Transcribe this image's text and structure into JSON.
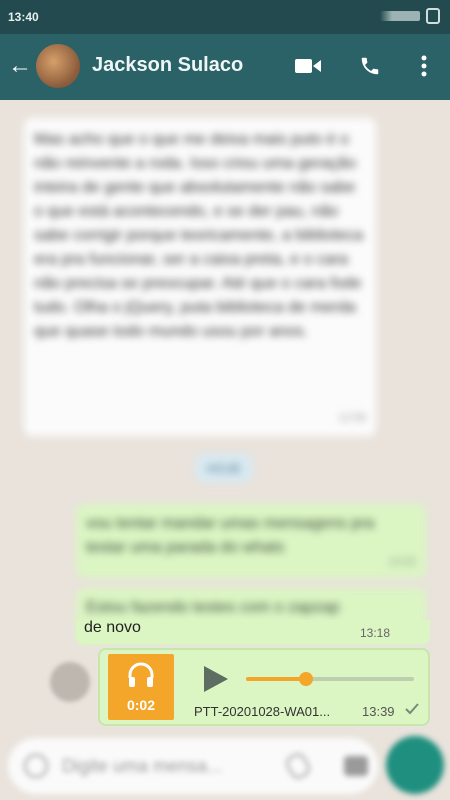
{
  "status": {
    "time": "13:40"
  },
  "header": {
    "contact_name": "Jackson Sulaco"
  },
  "messages": {
    "incoming_text": "Mas acho que o que me deixa mais puto é o não reinvente a roda. Isso criou uma geração inteira de gente que absolutamente não sabe o que está acontecendo, e se der pau, não sabe corrigir porque teoricamente, a biblioteca era pra funcionar, ser a caixa preta, e o cara não precisa se preocupar. Até que o cara fode tudo. Olha o jQuery, puta biblioteca de merda que quase todo mundo usou por anos.",
    "incoming_time": "12:58",
    "date_chip": "HOJE",
    "out1_text": "vou tentar mandar umas mensagens pra testar uma parada do whats",
    "out1_time": "13:02",
    "out2_text": "Estou fazendo testes com o zapzap",
    "out3_text": "de novo",
    "out3_time": "13:18"
  },
  "audio": {
    "duration": "0:02",
    "filename": "PTT-20201028-WA01...",
    "time": "13:39",
    "progress": 0.36,
    "accent": "#f4a62a"
  },
  "composer": {
    "placeholder": "Digite uma mensa..."
  },
  "colors": {
    "header": "#2a6268",
    "outgoing_bubble": "#dbf5c3",
    "fab": "#1f8f7f"
  }
}
